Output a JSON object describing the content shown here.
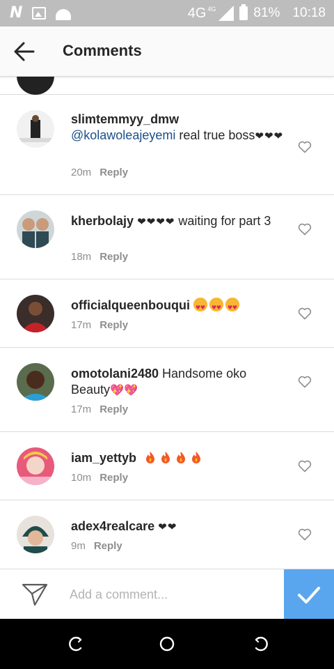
{
  "status_bar": {
    "network": "4G",
    "network_sup": "4G",
    "battery": "81%",
    "time": "10:18",
    "icons": [
      "n-icon",
      "image-icon",
      "android-icon",
      "signal-icon",
      "battery-icon"
    ]
  },
  "header": {
    "title": "Comments",
    "back_icon": "arrow-left-icon"
  },
  "comments": [
    {
      "username": "slimtemmyy_dmw",
      "mention": "@kolawoleajeyemi",
      "text": " real true boss",
      "hearts": "❤❤❤",
      "time": "20m",
      "reply": "Reply"
    },
    {
      "username": "kherbolajy",
      "hearts": "❤❤❤❤",
      "text": " waiting for part 3",
      "time": "18m",
      "reply": "Reply"
    },
    {
      "username": "officialqueenbouqui",
      "emoji": "heart-eyes-emoji x3",
      "time": "17m",
      "reply": "Reply"
    },
    {
      "username": "omotolani2480",
      "text": " Handsome oko Beauty",
      "hearts": "💖💖",
      "time": "17m",
      "reply": "Reply"
    },
    {
      "username": "iam_yettyb",
      "emoji": "fire-emoji x4",
      "time": "10m",
      "reply": "Reply"
    },
    {
      "username": "adex4realcare",
      "hearts": "❤❤",
      "time": "9m",
      "reply": "Reply"
    }
  ],
  "composer": {
    "placeholder": "Add a comment...",
    "send_icon": "paper-plane-icon",
    "post_icon": "checkmark-icon"
  },
  "colors": {
    "status_bar": "#bdbdbd",
    "header_bg": "#fafafa",
    "mention": "#1b4f8b",
    "meta_gray": "#8e8e8e",
    "post_button": "#5aa6ee",
    "divider": "#dbdbdb"
  }
}
